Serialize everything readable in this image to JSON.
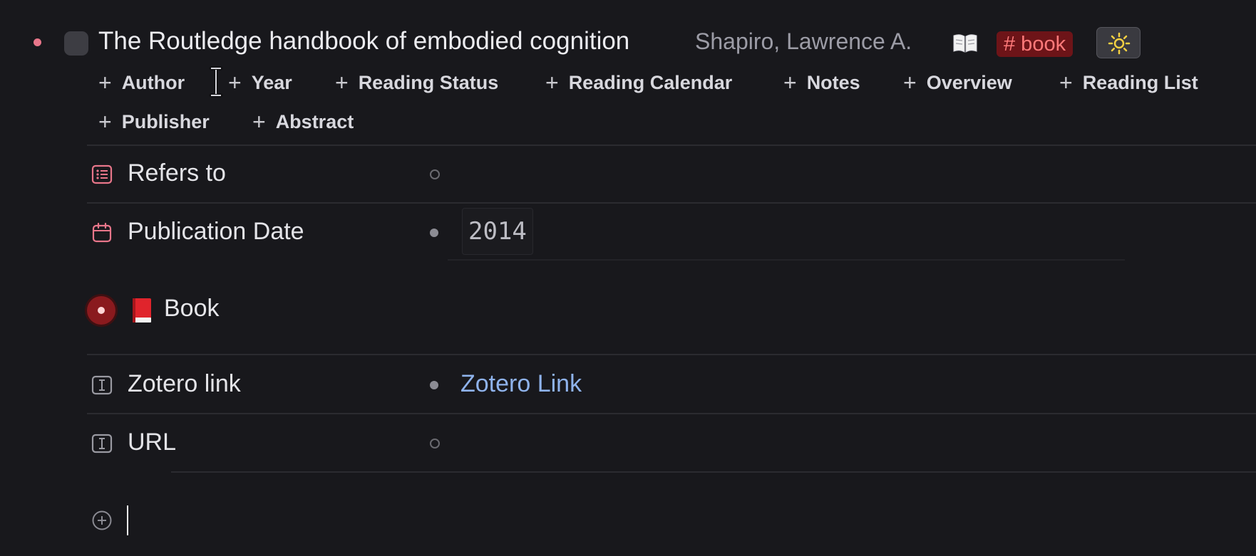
{
  "block": {
    "title": "The Routledge handbook of embodied cognition",
    "author": "Shapiro, Lawrence A.",
    "tag": "# book",
    "theme_icon": "sun-icon",
    "book_icon": "open-book-icon"
  },
  "add_fields": {
    "row1": [
      "Author",
      "Year",
      "Reading Status",
      "Reading Calendar",
      "Notes",
      "Overview",
      "Reading List"
    ],
    "row2": [
      "Publisher",
      "Abstract"
    ],
    "plus": "+"
  },
  "properties": {
    "refers_to": {
      "label": "Refers to",
      "icon": "list-icon"
    },
    "publication_date": {
      "label": "Publication Date",
      "value": "2014",
      "icon": "calendar-icon"
    },
    "book": {
      "label": "Book",
      "icon": "red-book-icon"
    },
    "zotero_link": {
      "label": "Zotero link",
      "value": "Zotero Link",
      "icon": "text-field-icon"
    },
    "url": {
      "label": "URL",
      "icon": "text-field-icon"
    }
  },
  "colors": {
    "background": "#18181c",
    "tag_bg": "#6d1418",
    "tag_text": "#ff7a7a",
    "link": "#8fb3ec",
    "accent_pink": "#e8768a"
  }
}
